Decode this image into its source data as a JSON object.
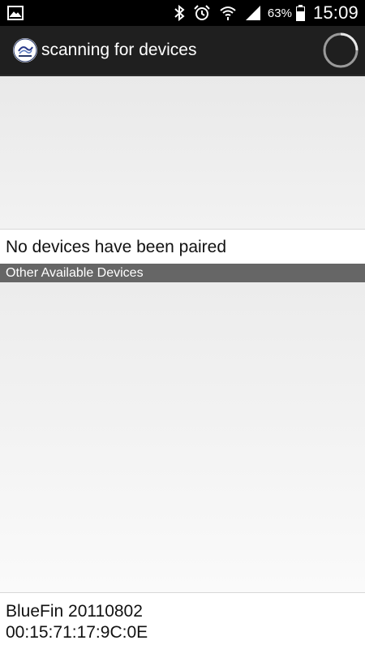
{
  "status_bar": {
    "left_icon": "image-icon",
    "icons": [
      "bluetooth-icon",
      "alarm-icon",
      "wifi-icon",
      "signal-icon",
      "battery-icon"
    ],
    "battery_percent": "63%",
    "time": "15:09"
  },
  "action_bar": {
    "logo_icon": "bluefin-logo-icon",
    "title": "scanning for devices",
    "spinner_icon": "progress-spinner-icon"
  },
  "paired": {
    "empty_text": "No devices have been paired"
  },
  "available": {
    "header": "Other Available Devices",
    "devices": [
      {
        "name": "BlueFin 20110802",
        "address": "00:15:71:17:9C:0E"
      }
    ]
  },
  "colors": {
    "status_bar_bg": "#000000",
    "action_bar_bg": "#1f1f1f",
    "section_header_bg": "#666666",
    "text": "#111111"
  }
}
